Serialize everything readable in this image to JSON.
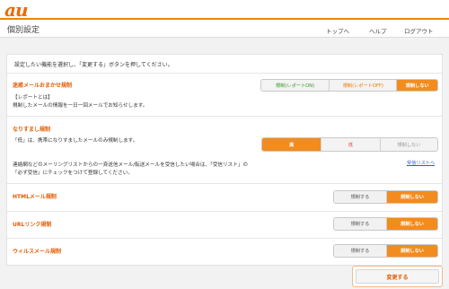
{
  "brand": {
    "logo": "au",
    "accent": "#f08300"
  },
  "header": {
    "title": "個別設定",
    "nav": [
      "トップへ",
      "ヘルプ",
      "ログアウト"
    ]
  },
  "intro": "設定したい機能を選択し、「変更する」ボタンを押してください。",
  "sections": {
    "omakase": {
      "title": "迷惑メールおまかせ規制",
      "line1": "【レポートとは】",
      "line2": "規制したメールの情報を一日一回メールでお知らせします。",
      "options": [
        "規制(レポートON)",
        "規制(レポートOFF)",
        "規制しない"
      ],
      "selected": "規制しない"
    },
    "spoof": {
      "title": "なりすまし規制",
      "line1": "「低」は、携帯になりすましたメールのみ規制します。",
      "options": [
        "高",
        "低",
        "規制しない"
      ],
      "selected": "高",
      "note1": "連絡網などのメーリングリストからの一斉送信メール/転送メールを受信したい場合は、「受信リスト」の",
      "note2": "「必ず受信」にチェックをつけて登録してください。",
      "link": "受信リストへ"
    },
    "html": {
      "title": "HTMLメール規制",
      "options": [
        "規制する",
        "規制しない"
      ],
      "selected": "規制しない"
    },
    "url": {
      "title": "URLリンク規制",
      "options": [
        "規制する",
        "規制しない"
      ],
      "selected": "規制しない"
    },
    "virus": {
      "title": "ウィルスメール規制",
      "options": [
        "規制する",
        "規制しない"
      ],
      "selected": "規制しない"
    }
  },
  "submit_label": "変更する"
}
